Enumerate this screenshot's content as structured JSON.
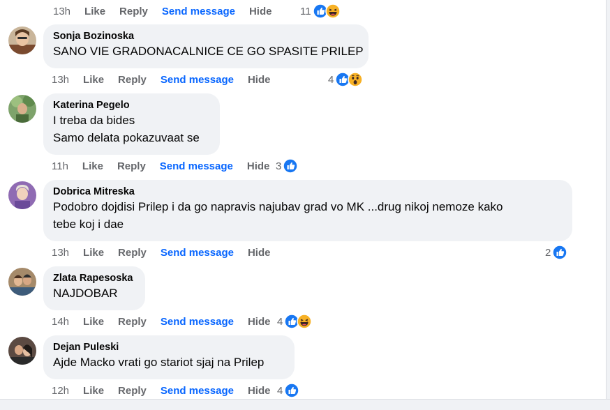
{
  "top_actions": {
    "time": "13h",
    "like": "Like",
    "reply": "Reply",
    "send": "Send message",
    "hide": "Hide",
    "reaction_count": "11",
    "reactions": [
      "like-icon",
      "haha-icon"
    ]
  },
  "comments": [
    {
      "author": "Sonja Bozinoska",
      "lines": [
        "SANO VIE GRADONACALNICE CE GO SPASITE PRILEP"
      ],
      "time": "13h",
      "like": "Like",
      "reply": "Reply",
      "send": "Send message",
      "hide": "Hide",
      "reaction_count": "4",
      "reactions": [
        "like-icon",
        "wow-icon"
      ]
    },
    {
      "author": "Katerina Pegelo",
      "lines": [
        "I treba da bides",
        "Samo delata pokazuvaat se"
      ],
      "time": "11h",
      "like": "Like",
      "reply": "Reply",
      "send": "Send message",
      "hide": "Hide",
      "reaction_count": "3",
      "reactions": [
        "like-icon"
      ]
    },
    {
      "author": "Dobrica Mitreska",
      "lines": [
        "Podobro dojdisi Prilep i da go napravis najubav grad vo MK ...drug nikoj nemoze kako",
        "tebe koj i dae"
      ],
      "time": "13h",
      "like": "Like",
      "reply": "Reply",
      "send": "Send message",
      "hide": "Hide",
      "reaction_count": "2",
      "reactions": [
        "like-icon"
      ]
    },
    {
      "author": "Zlata Rapesoska",
      "lines": [
        "NAJDOBAR"
      ],
      "time": "14h",
      "like": "Like",
      "reply": "Reply",
      "send": "Send message",
      "hide": "Hide",
      "reaction_count": "4",
      "reactions": [
        "like-icon",
        "haha-icon"
      ]
    },
    {
      "author": "Dejan Puleski",
      "lines": [
        "Ajde Macko vrati go stariot sjaj na Prilep"
      ],
      "time": "12h",
      "like": "Like",
      "reply": "Reply",
      "send": "Send message",
      "hide": "Hide",
      "reaction_count": "4",
      "reactions": [
        "like-icon"
      ]
    }
  ],
  "colors": {
    "link": "#0866ff",
    "meta": "#65676b",
    "bubble": "#f0f2f5",
    "like_blue": "#1877f2",
    "emoji_yellow": "#f7b125"
  }
}
